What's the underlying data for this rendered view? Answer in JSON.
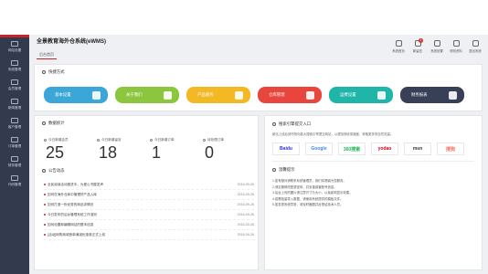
{
  "app": {
    "title": "全景教育海外仓系统(eWMS)"
  },
  "tabs": [
    {
      "label": "后台首页"
    }
  ],
  "toolbar": [
    {
      "label": "系统首页",
      "icon": "home-icon"
    },
    {
      "label": "新留言",
      "icon": "message-icon",
      "badge": "1"
    },
    {
      "label": "系统设置",
      "icon": "settings-icon"
    },
    {
      "label": "修改资料",
      "icon": "user-icon"
    },
    {
      "label": "退出系统",
      "icon": "power-icon"
    }
  ],
  "sidebar": {
    "items": [
      {
        "label": "网站设置"
      },
      {
        "label": "系统管理"
      },
      {
        "label": "会员管理"
      },
      {
        "label": "新闻管理"
      },
      {
        "label": "客户管理"
      },
      {
        "label": "订单管理"
      },
      {
        "label": "财务管理"
      },
      {
        "label": "代码管理"
      }
    ]
  },
  "quick": {
    "title": "快捷方式",
    "buttons": [
      {
        "label": "基本设置",
        "color": "#3aa7d8"
      },
      {
        "label": "关于我们",
        "color": "#8cc63f"
      },
      {
        "label": "产品服务",
        "color": "#f3b824"
      },
      {
        "label": "仓库管理",
        "color": "#e8453c"
      },
      {
        "label": "运费设置",
        "color": "#1fb5a9"
      },
      {
        "label": "财务报表",
        "color": "#384057"
      }
    ]
  },
  "stats": {
    "title": "数据统计",
    "items": [
      {
        "label": "今日新增会员",
        "value": "25"
      },
      {
        "label": "今日新增留言",
        "value": "18"
      },
      {
        "label": "今日新增订单",
        "value": "1"
      },
      {
        "label": "待处理订单",
        "value": "0"
      }
    ]
  },
  "news": {
    "title": "公告动态",
    "items": [
      {
        "title": "全民阅读活动推进中，为爱心书屋发声",
        "date": "2016-09-26"
      },
      {
        "title": "如何在海外仓库中管理好产品入库",
        "date": "2016-09-26"
      },
      {
        "title": "如何打造一份优秀的商品详情页",
        "date": "2016-09-26"
      },
      {
        "title": "今日发布的后台管理系统工作准则",
        "date": "2016-09-26"
      },
      {
        "title": "如何设置和编辑网站的基本信息",
        "date": "2016-09-26"
      },
      {
        "title": "[活动]网购商城首单满减优惠券正式上线",
        "date": "2016-09-26"
      }
    ]
  },
  "search_entry": {
    "title": "搜索引擎提交入口",
    "text": "新站上线后请尽快向各大搜索引擎提交网站，以便加快收录速度，获取更多的自然流量。",
    "engines": [
      {
        "name": "Baidu",
        "color": "#2932e1"
      },
      {
        "name": "Google",
        "color": "#4285f4"
      },
      {
        "name": "360搜索",
        "color": "#19b955"
      },
      {
        "name": "yodao",
        "color": "#d0021b"
      },
      {
        "name": "msn",
        "color": "#333333"
      },
      {
        "name": "搜狗",
        "color": "#fd6853"
      }
    ]
  },
  "tips": {
    "title": "温馨提示",
    "items": [
      "1.如有疑问请联系系统管理员，我们将竭诚为您服务。",
      "2.请定期修改登录密码，并妥善保管账号信息。",
      "3.后台上传的图片请注意尺寸与大小，以免影响显示效果。",
      "4.若需批量导入数据，请使用系统提供的模板文件。",
      "5.如发现系统异常，请及时截图并反馈给技术人员。"
    ]
  }
}
